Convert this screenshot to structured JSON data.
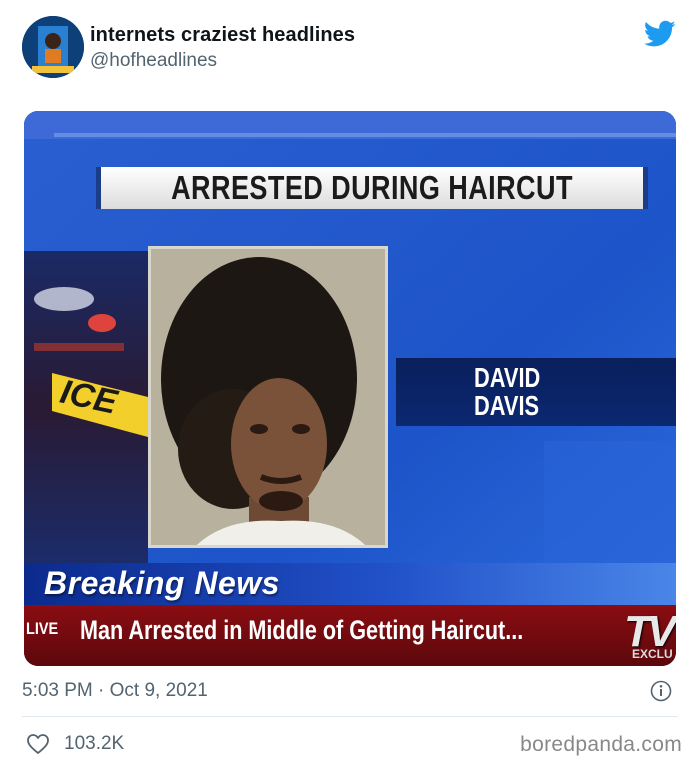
{
  "tweet": {
    "display_name": "internets craziest headlines",
    "handle": "@hofheadlines",
    "timestamp": "5:03 PM · Oct 9, 2021",
    "like_count": "103.2K"
  },
  "media": {
    "headline": "ARRESTED DURING HAIRCUT",
    "name_first": "DAVID",
    "name_last": "DAVIS",
    "breaking_label": "Breaking News",
    "live_tag": "LIVE",
    "ticker": "Man Arrested in Middle of Getting Haircut...",
    "logo_text": "TV",
    "logo_sub": "EXCLU",
    "tape_text": "ICE"
  },
  "watermark": "boredpanda.com",
  "colors": {
    "twitter_blue": "#1d9bf0",
    "secondary_text": "#536471",
    "news_blue": "#1f4fb5",
    "ticker_red": "#7a0b10"
  },
  "icons": {
    "brand": "twitter-bird-icon",
    "info": "info-icon",
    "like": "heart-icon"
  }
}
